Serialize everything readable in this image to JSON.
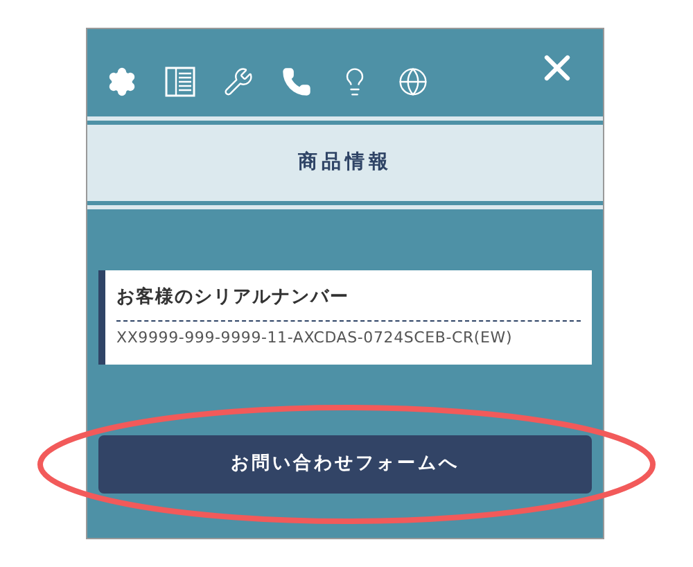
{
  "header": {
    "title": "商品情報"
  },
  "serial_card": {
    "label": "お客様のシリアルナンバー",
    "value": "XX9999-999-9999-11-AXCDAS-0724SCEB-CR(EW)"
  },
  "contact_button": {
    "label": "お問い合わせフォームへ"
  }
}
